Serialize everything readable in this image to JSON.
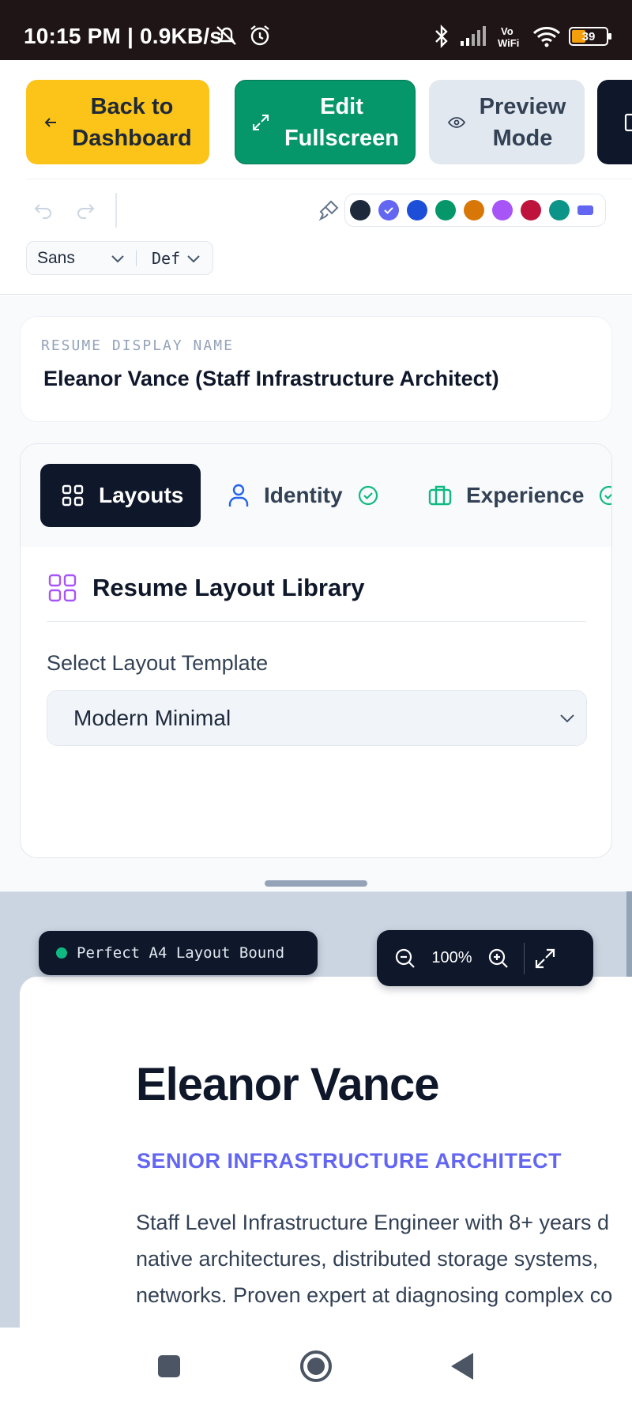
{
  "status_bar": {
    "time": "10:15 PM | 0.9KB/s",
    "battery": "39"
  },
  "toolbar": {
    "back_label": "Back to\nDashboard",
    "edit_label": "Edit\nFullscreen",
    "preview_label": "Preview\nMode",
    "font_family": "Sans",
    "font_size": "Def",
    "palette": [
      "#1e293b",
      "#6366f1",
      "#1d4ed8",
      "#059669",
      "#d97706",
      "#a855f7",
      "#be123c",
      "#0d9488",
      "#6366f1"
    ],
    "selected_color_index": 1
  },
  "resume": {
    "display_name_caption": "RESUME DISPLAY NAME",
    "display_name": "Eleanor Vance (Staff Infrastructure Architect)"
  },
  "tabs": [
    {
      "label": "Layouts",
      "icon": "grid-icon",
      "active": true
    },
    {
      "label": "Identity",
      "icon": "user-icon",
      "complete": true
    },
    {
      "label": "Experience",
      "icon": "briefcase-icon",
      "complete": true
    }
  ],
  "layout_panel": {
    "title": "Resume Layout Library",
    "select_label": "Select Layout Template",
    "selected_template": "Modern Minimal"
  },
  "preview": {
    "badge": "Perfect A4 Layout Bound",
    "zoom": "100%",
    "name": "Eleanor Vance",
    "title": "SENIOR INFRASTRUCTURE ARCHITECT",
    "summary_lines": [
      "Staff Level Infrastructure Engineer with 8+ years d",
      "native architectures, distributed storage systems,",
      "networks. Proven expert at diagnosing complex co"
    ]
  }
}
